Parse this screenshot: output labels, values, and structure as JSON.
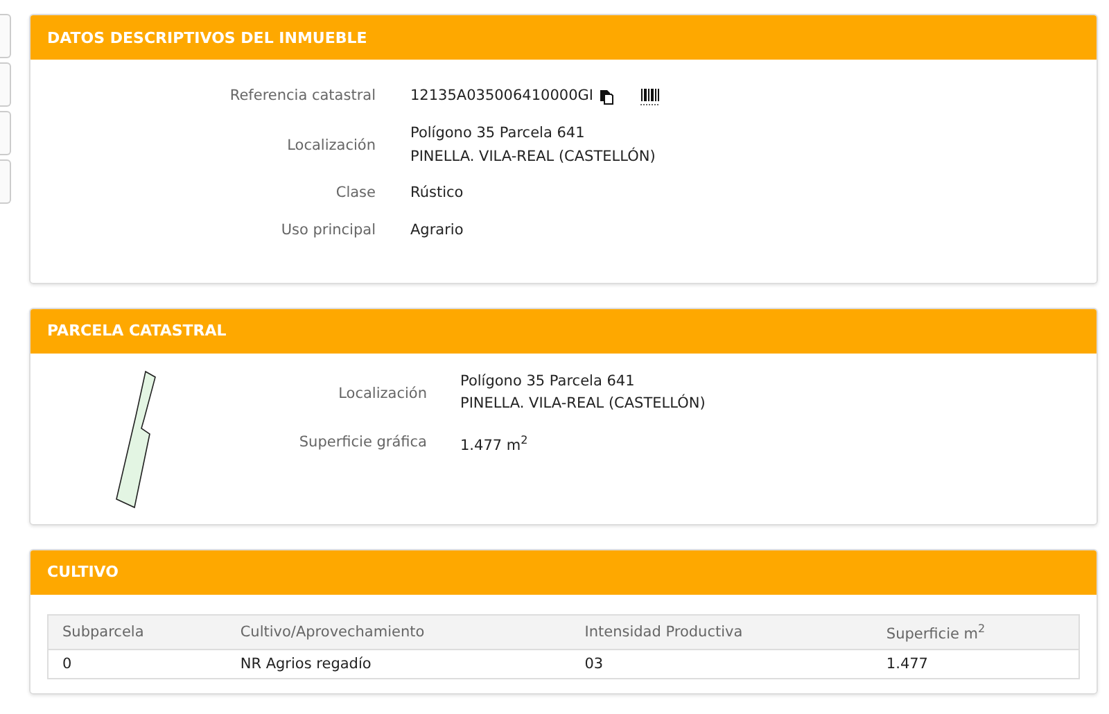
{
  "inmueble": {
    "title": "DATOS DESCRIPTIVOS DEL INMUEBLE",
    "fields": [
      {
        "kind": "reference",
        "label": "Referencia catastral",
        "lines": [
          "12135A035006410000GI"
        ]
      },
      {
        "kind": "text",
        "label": "Localización",
        "lines": [
          "Polígono 35 Parcela 641",
          "PINELLA. VILA-REAL (CASTELLÓN)"
        ]
      },
      {
        "kind": "text",
        "label": "Clase",
        "lines": [
          "Rústico"
        ]
      },
      {
        "kind": "text",
        "label": "Uso principal",
        "lines": [
          "Agrario"
        ]
      }
    ]
  },
  "parcela": {
    "title": "PARCELA CATASTRAL",
    "fields": [
      {
        "label": "Localización",
        "lines": [
          "Polígono 35 Parcela 641",
          "PINELLA. VILA-REAL (CASTELLÓN)"
        ]
      },
      {
        "label": "Superficie gráfica",
        "lines": [
          "1.477 m$^{2}$"
        ]
      }
    ]
  },
  "cultivo": {
    "title": "CULTIVO",
    "table": {
      "columns": [
        "Subparcela",
        "Cultivo/Aprovechamiento",
        "Intensidad Productiva",
        "Superficie m$^{2}$"
      ],
      "rows": [
        [
          "0",
          "NR Agrios regadío",
          "03",
          "1.477"
        ]
      ]
    }
  }
}
